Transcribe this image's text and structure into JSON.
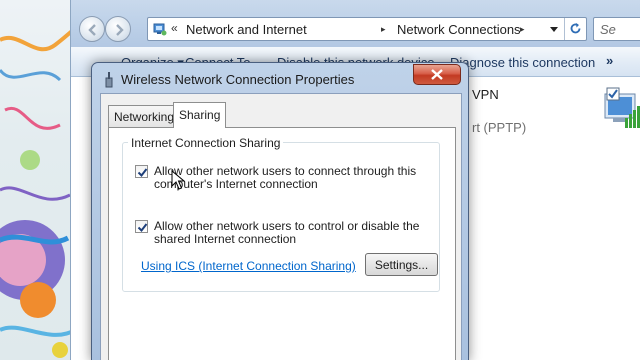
{
  "explorer": {
    "breadcrumb": {
      "overflow": "«",
      "items": [
        "Network and Internet",
        "Network Connections"
      ],
      "separator": "▸"
    },
    "search_placeholder": "Se",
    "commands": [
      "Organize ▾",
      "Connect To",
      "Disable this network device",
      "Diagnose this connection"
    ],
    "commands_overflow": "»",
    "connection": {
      "name": "VPN",
      "subtitle": "rt (PPTP)"
    }
  },
  "dialog": {
    "title": "Wireless Network Connection Properties",
    "tabs": [
      "Networking",
      "Sharing"
    ],
    "active_tab": "Sharing",
    "group_label": "Internet Connection Sharing",
    "options": [
      {
        "line1": "Allow other network users to connect through this",
        "line2": "computer's Internet connection",
        "checked": true
      },
      {
        "line1": "Allow other network users to control or disable the",
        "line2": "shared Internet connection",
        "checked": true
      }
    ],
    "help_link": "Using ICS (Internet Connection Sharing)",
    "settings_button": "Settings..."
  },
  "colors": {
    "link": "#0066cc",
    "close_button": "#c23a22",
    "title_bar": "#bfd2e9"
  }
}
